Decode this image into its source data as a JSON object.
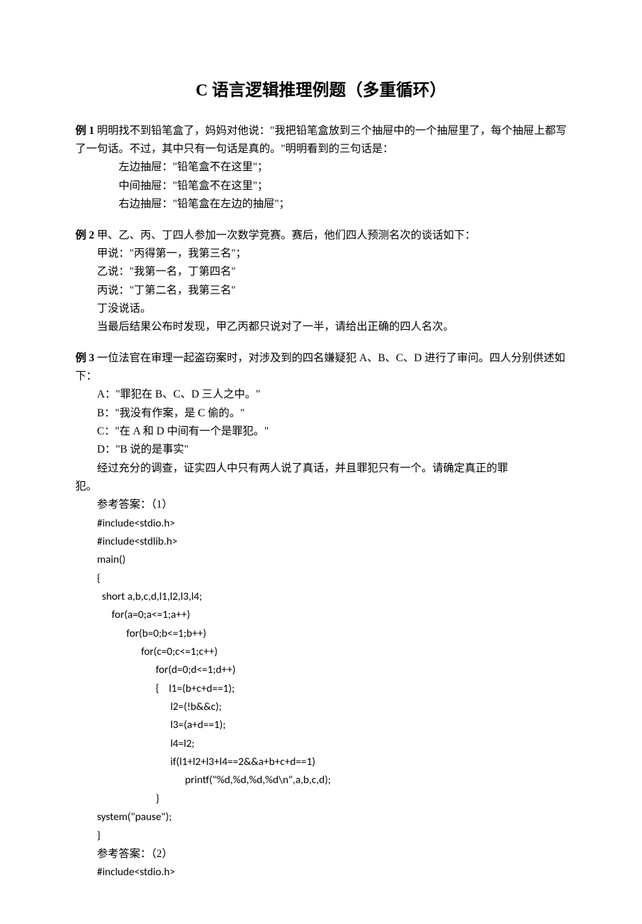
{
  "title": "C 语言逻辑推理例题（多重循环）",
  "ex1": {
    "label": "例 1",
    "intro": " 明明找不到铅笔盒了，妈妈对他说：\"我把铅笔盒放到三个抽屉中的一个抽屉里了，每个抽屉上都写了一句话。不过，其中只有一句话是真的。\"明明看到的三句话是：",
    "l1": "左边抽屉：\"铅笔盒不在这里\"；",
    "l2": "中间抽屉：\"铅笔盒不在这里\"；",
    "l3": "右边抽屉：\"铅笔盒在左边的抽屉\"；"
  },
  "ex2": {
    "label": "例 2",
    "intro": " 甲、乙、丙、丁四人参加一次数学竞赛。赛后，他们四人预测名次的谈话如下：",
    "l1": "甲说：\"丙得第一，我第三名\"；",
    "l2": "乙说：\"我第一名，丁第四名\"",
    "l3": "丙说：\"丁第二名，我第三名\"",
    "l4": "丁没说话。",
    "l5": "当最后结果公布时发现，甲乙丙都只说对了一半，请给出正确的四人名次。"
  },
  "ex3": {
    "label": "例 3",
    "intro": " 一位法官在审理一起盗窃案时，对涉及到的四名嫌疑犯 A、B、C、D 进行了审问。四人分别供述如下：",
    "l1": "A：\"罪犯在 B、C、D 三人之中。\"",
    "l2": "B：\"我没有作案，是 C 偷的。\"",
    "l3": "C：\"在 A 和 D 中间有一个是罪犯。\"",
    "l4": "D：\"B 说的是事实\"",
    "l5_a": "经过充分的调查，证实四人中只有两人说了真话，并且罪犯只有一个。请确定真正的罪",
    "l5_b": "犯。"
  },
  "ans1": {
    "label": "参考答案：（1）",
    "c1": "#include<stdio.h>",
    "c2": "#include<stdlib.h>",
    "c3": "main()",
    "c4": "{",
    "c5": "  short a,b,c,d,l1,l2,l3,l4;",
    "c6": "      for(a=0;a<=1;a++)",
    "c7": "            for(b=0;b<=1;b++)",
    "c8": "                  for(c=0;c<=1;c++)",
    "c9": "                        for(d=0;d<=1;d++)",
    "c10": "                        {    l1=(b+c+d==1);",
    "c11": "                              l2=(!b&&c);",
    "c12": "                              l3=(a+d==1);",
    "c13": "                              l4=l2;",
    "c14": "                              if(l1+l2+l3+l4==2&&a+b+c+d==1)",
    "c15": "                                    printf(\"%d,%d,%d,%d\\n\",a,b,c,d);",
    "c16": "                        }",
    "c17": "system(\"pause\");",
    "c18": "}"
  },
  "ans2": {
    "label": "参考答案：（2）",
    "c1": "#include<stdio.h>"
  }
}
